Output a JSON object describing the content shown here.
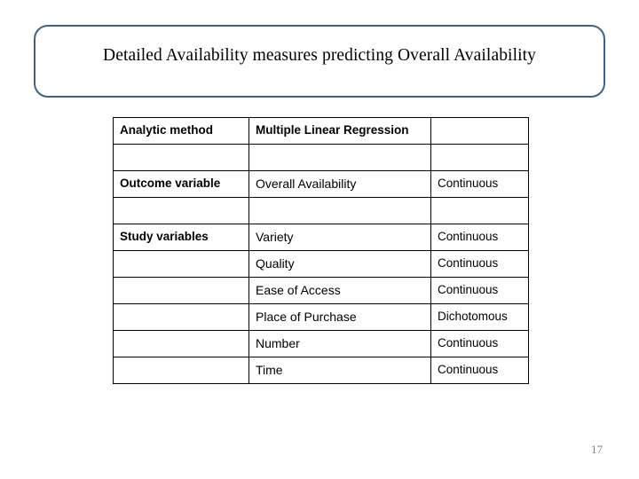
{
  "slide": {
    "title": "Detailed Availability measures predicting Overall Availability",
    "number": "17",
    "accent_color": "#41627e"
  },
  "table": {
    "rows": [
      {
        "label": "Analytic method",
        "value": "Multiple Linear Regression",
        "type": ""
      },
      {
        "label": "",
        "value": "",
        "type": ""
      },
      {
        "label": "Outcome variable",
        "value": "Overall Availability",
        "type": "Continuous"
      },
      {
        "label": "",
        "value": "",
        "type": ""
      },
      {
        "label": "Study variables",
        "value": "Variety",
        "type": "Continuous"
      },
      {
        "label": "",
        "value": "Quality",
        "type": "Continuous"
      },
      {
        "label": "",
        "value": "Ease of Access",
        "type": "Continuous"
      },
      {
        "label": "",
        "value": "Place of Purchase",
        "type": "Dichotomous"
      },
      {
        "label": "",
        "value": "Number",
        "type": "Continuous"
      },
      {
        "label": "",
        "value": "Time",
        "type": "Continuous"
      }
    ]
  }
}
